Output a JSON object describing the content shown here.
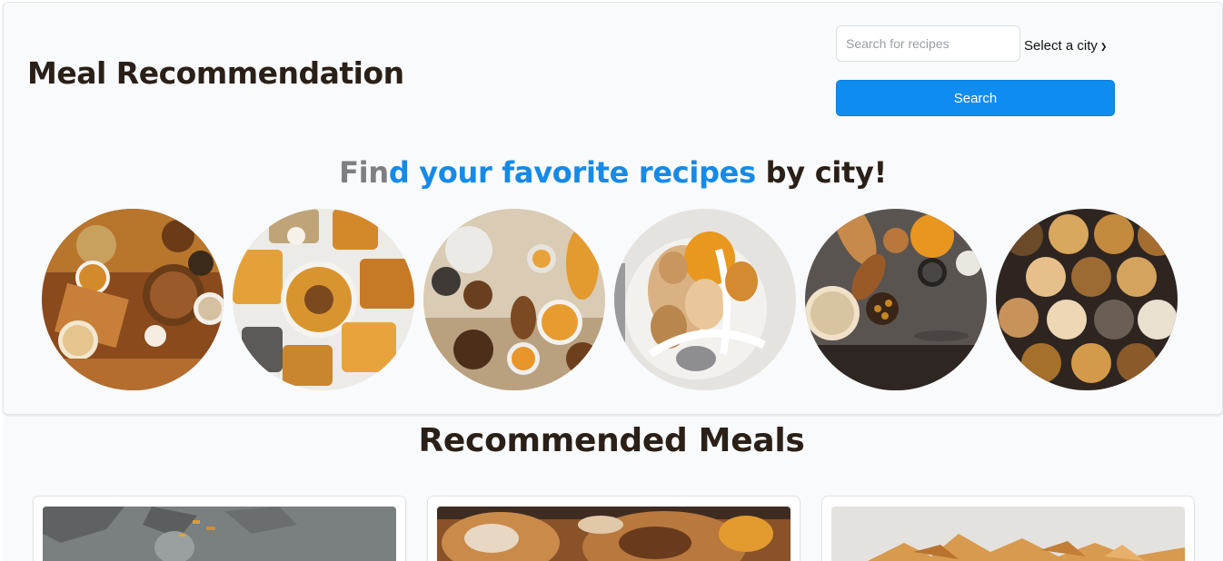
{
  "header": {
    "title": "Meal Recommendation",
    "search_placeholder": "Search for recipes",
    "search_value": "",
    "city_select_label": "Select a city",
    "search_button_label": "Search"
  },
  "hero": {
    "tagline_part1": "Fin",
    "tagline_part2": "d your favorite recipes",
    "tagline_part3": " by city!",
    "food_images": [
      {
        "icon": "spices-photo"
      },
      {
        "icon": "snack-platter-photo"
      },
      {
        "icon": "mixed-dishes-photo"
      },
      {
        "icon": "fruit-and-measuring-tape-photo"
      },
      {
        "icon": "bread-and-nuts-photo"
      },
      {
        "icon": "nut-bowls-photo"
      }
    ]
  },
  "meals": {
    "section_title": "Recommended Meals",
    "cards": [
      {
        "icon": "meal-photo-1"
      },
      {
        "icon": "meal-photo-2"
      },
      {
        "icon": "meal-photo-3"
      }
    ]
  },
  "colors": {
    "accent": "#0e8cf0",
    "tagline_blue": "#168ae6",
    "tagline_grey": "#7d7f82",
    "text_dark": "#2a2018"
  }
}
